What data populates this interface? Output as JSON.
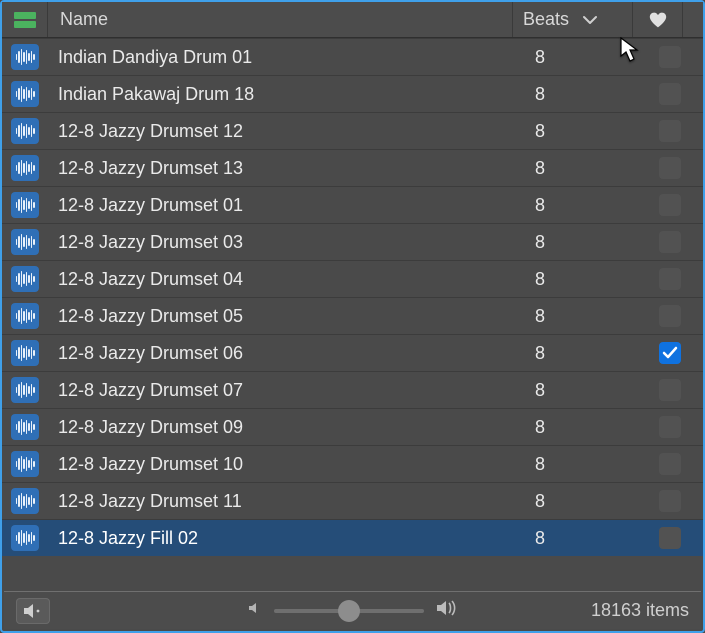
{
  "header": {
    "name_label": "Name",
    "beats_label": "Beats",
    "sort_column": "Beats",
    "sort_direction": "desc"
  },
  "rows": [
    {
      "name": "Indian Dandiya Drum 01",
      "beats": "8",
      "favorite": false,
      "selected": false
    },
    {
      "name": "Indian Pakawaj Drum 18",
      "beats": "8",
      "favorite": false,
      "selected": false
    },
    {
      "name": "12-8 Jazzy Drumset 12",
      "beats": "8",
      "favorite": false,
      "selected": false
    },
    {
      "name": "12-8 Jazzy Drumset 13",
      "beats": "8",
      "favorite": false,
      "selected": false
    },
    {
      "name": "12-8 Jazzy Drumset 01",
      "beats": "8",
      "favorite": false,
      "selected": false
    },
    {
      "name": "12-8 Jazzy Drumset 03",
      "beats": "8",
      "favorite": false,
      "selected": false
    },
    {
      "name": "12-8 Jazzy Drumset 04",
      "beats": "8",
      "favorite": false,
      "selected": false
    },
    {
      "name": "12-8 Jazzy Drumset 05",
      "beats": "8",
      "favorite": false,
      "selected": false
    },
    {
      "name": "12-8 Jazzy Drumset 06",
      "beats": "8",
      "favorite": true,
      "selected": false
    },
    {
      "name": "12-8 Jazzy Drumset 07",
      "beats": "8",
      "favorite": false,
      "selected": false
    },
    {
      "name": "12-8 Jazzy Drumset 09",
      "beats": "8",
      "favorite": false,
      "selected": false
    },
    {
      "name": "12-8 Jazzy Drumset 10",
      "beats": "8",
      "favorite": false,
      "selected": false
    },
    {
      "name": "12-8 Jazzy Drumset 11",
      "beats": "8",
      "favorite": false,
      "selected": false
    },
    {
      "name": "12-8 Jazzy Fill 02",
      "beats": "8",
      "favorite": false,
      "selected": true
    }
  ],
  "footer": {
    "volume_percent": 50,
    "item_count_label": "18163 items"
  }
}
